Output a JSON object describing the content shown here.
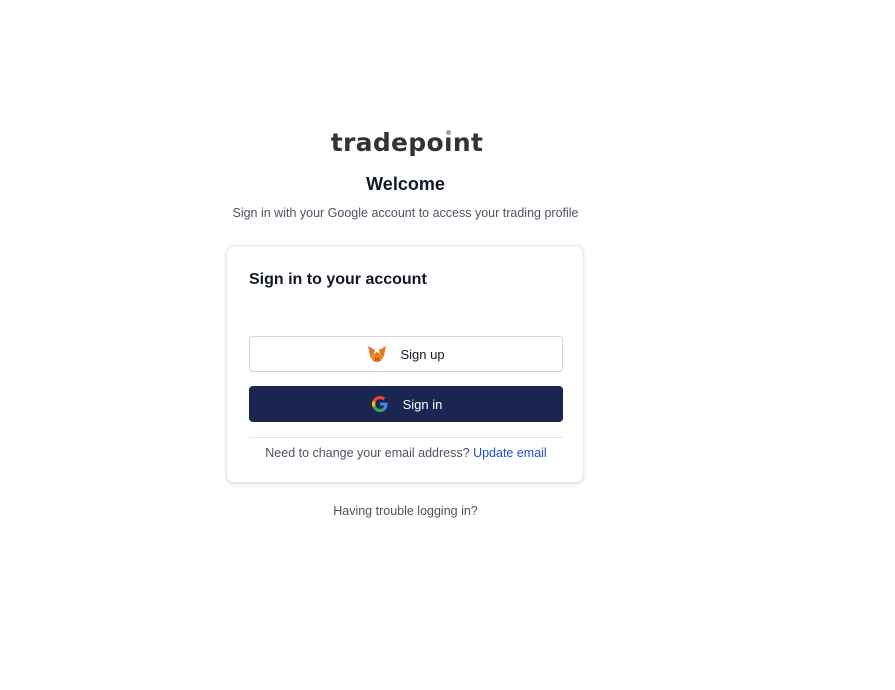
{
  "brand": {
    "logo_parts": [
      "tradepo",
      "ı",
      "nt"
    ]
  },
  "header": {
    "title": "Welcome",
    "subtitle": "Sign in with your Google account to access your trading profile"
  },
  "card": {
    "title": "Sign in to your account",
    "signup_button": {
      "label": "Sign up",
      "icon": "metamask-fox-icon"
    },
    "signin_button": {
      "label": "Sign in",
      "icon": "google-icon"
    },
    "email_prompt": "Need to change your email address?",
    "update_email_link": "Update email"
  },
  "footer": {
    "trouble_link": "Having trouble logging in?"
  },
  "colors": {
    "primary_button": "#1b2551",
    "link": "#1d4ed8",
    "muted_text": "#4b5563"
  }
}
